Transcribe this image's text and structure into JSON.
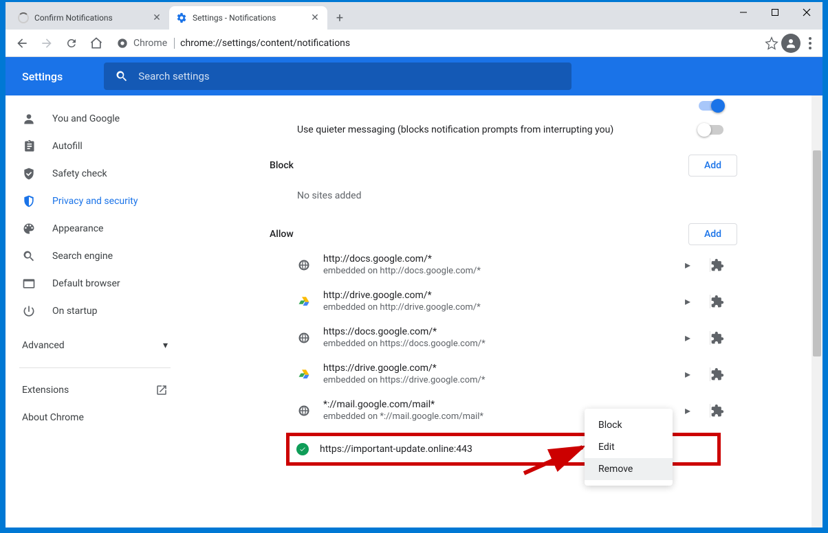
{
  "tabs": [
    {
      "title": "Confirm Notifications",
      "active": false
    },
    {
      "title": "Settings - Notifications",
      "active": true
    }
  ],
  "omnibox": {
    "chrome_label": "Chrome",
    "url": "chrome://settings/content/notifications"
  },
  "header": {
    "title": "Settings",
    "search_placeholder": "Search settings"
  },
  "sidebar": {
    "items": [
      {
        "label": "You and Google"
      },
      {
        "label": "Autofill"
      },
      {
        "label": "Safety check"
      },
      {
        "label": "Privacy and security"
      },
      {
        "label": "Appearance"
      },
      {
        "label": "Search engine"
      },
      {
        "label": "Default browser"
      },
      {
        "label": "On startup"
      }
    ],
    "advanced": "Advanced",
    "extensions": "Extensions",
    "about": "About Chrome"
  },
  "settings": {
    "quieter": "Use quieter messaging (blocks notification prompts from interrupting you)",
    "block_header": "Block",
    "add_button": "Add",
    "no_sites": "No sites added",
    "allow_header": "Allow",
    "allow_sites": [
      {
        "url": "http://docs.google.com/*",
        "embedded": "embedded on http://docs.google.com/*",
        "icon": "globe"
      },
      {
        "url": "http://drive.google.com/*",
        "embedded": "embedded on http://drive.google.com/*",
        "icon": "drive"
      },
      {
        "url": "https://docs.google.com/*",
        "embedded": "embedded on https://docs.google.com/*",
        "icon": "globe"
      },
      {
        "url": "https://drive.google.com/*",
        "embedded": "embedded on https://drive.google.com/*",
        "icon": "drive"
      },
      {
        "url": "*://mail.google.com/mail*",
        "embedded": "embedded on *://mail.google.com/mail*",
        "icon": "globe"
      }
    ],
    "highlighted_site": "https://important-update.online:443"
  },
  "context_menu": {
    "items": [
      "Block",
      "Edit",
      "Remove"
    ],
    "hover_index": 2
  }
}
